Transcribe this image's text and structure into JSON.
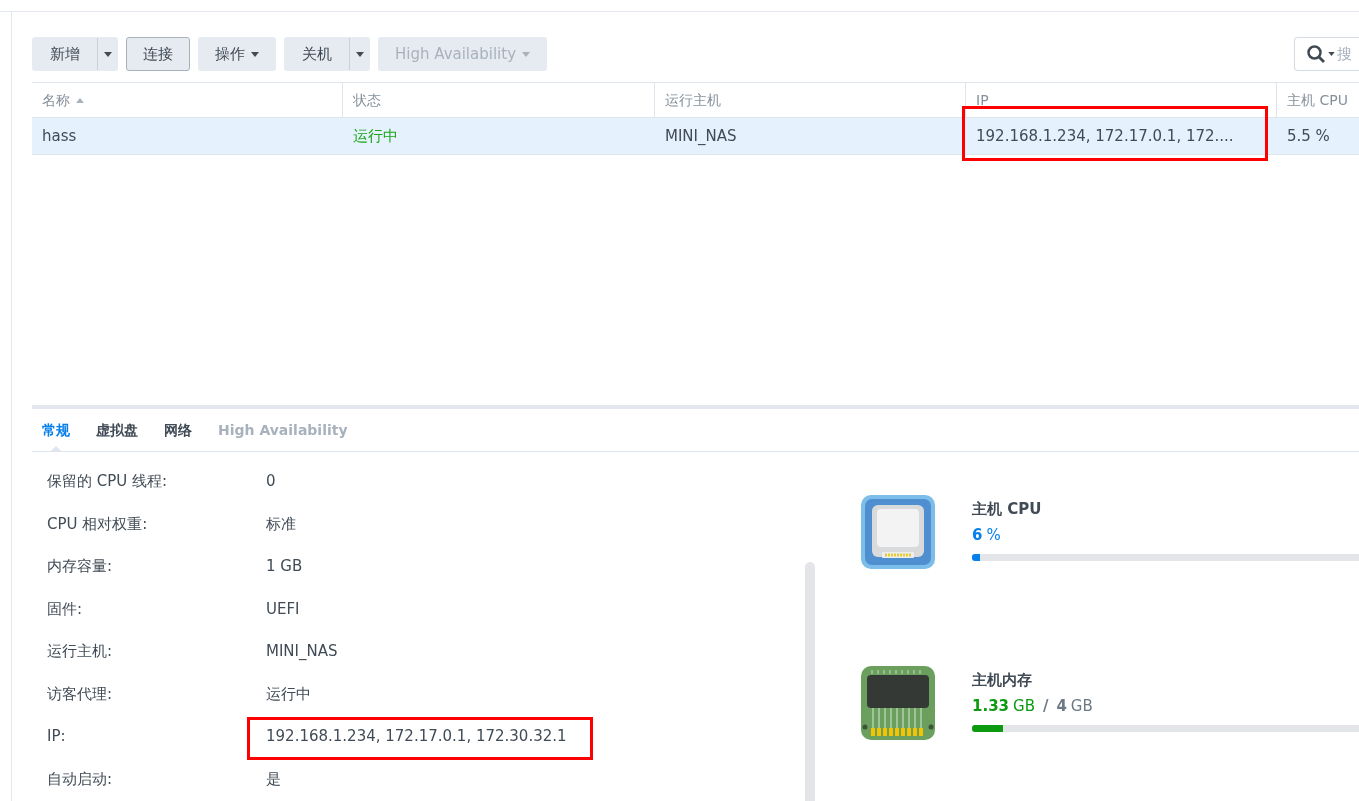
{
  "toolbar": {
    "buttons": [
      {
        "label": "新增",
        "kind": "split",
        "disabled": false,
        "pressed": false
      },
      {
        "label": "连接",
        "kind": "plain",
        "disabled": false,
        "pressed": true
      },
      {
        "label": "操作",
        "kind": "menu",
        "disabled": false,
        "pressed": false
      },
      {
        "label": "关机",
        "kind": "split",
        "disabled": false,
        "pressed": false
      },
      {
        "label": "High Availability",
        "kind": "menu",
        "disabled": true,
        "pressed": false
      }
    ],
    "search": {
      "placeholder": "搜"
    }
  },
  "table": {
    "columns": [
      {
        "label": "名称",
        "sorted": true
      },
      {
        "label": "状态",
        "sorted": false
      },
      {
        "label": "运行主机",
        "sorted": false
      },
      {
        "label": "IP",
        "sorted": false
      },
      {
        "label": "主机 CPU",
        "sorted": false
      }
    ],
    "rows": [
      {
        "selected": true,
        "cells": [
          {
            "text": "hass",
            "highlighted": false,
            "kind": "plain"
          },
          {
            "text": "运行中",
            "highlighted": false,
            "kind": "status"
          },
          {
            "text": "MINI_NAS",
            "highlighted": false,
            "kind": "plain"
          },
          {
            "text": "192.168.1.234, 172.17.0.1, 172....",
            "highlighted": true,
            "kind": "plain"
          },
          {
            "text": "5.5 %",
            "highlighted": false,
            "kind": "plain"
          }
        ]
      }
    ]
  },
  "detail_tabs": [
    {
      "label": "常规",
      "selected": true,
      "disabled": false
    },
    {
      "label": "虚拟盘",
      "selected": false,
      "disabled": false
    },
    {
      "label": "网络",
      "selected": false,
      "disabled": false
    },
    {
      "label": "High Availability",
      "selected": false,
      "disabled": true
    }
  ],
  "properties": [
    {
      "label": "保留的 CPU 线程:",
      "value": "0",
      "highlighted": false
    },
    {
      "label": "CPU 相对权重:",
      "value": "标准",
      "highlighted": false
    },
    {
      "label": "内存容量:",
      "value": "1 GB",
      "highlighted": false
    },
    {
      "label": "固件:",
      "value": "UEFI",
      "highlighted": false
    },
    {
      "label": "运行主机:",
      "value": "MINI_NAS",
      "highlighted": false
    },
    {
      "label": "访客代理:",
      "value": "运行中",
      "highlighted": false
    },
    {
      "label": "IP:",
      "value": "192.168.1.234, 172.17.0.1, 172.30.32.1",
      "highlighted": true
    },
    {
      "label": "自动启动:",
      "value": "是",
      "highlighted": false
    }
  ],
  "meters": [
    {
      "kind": "cpu",
      "title": "主机 CPU",
      "value": "6",
      "unit": "%",
      "level": 0.02
    },
    {
      "kind": "memory",
      "title": "主机内存",
      "value": "1.33",
      "unit": "GB",
      "separator": "/",
      "total": "4",
      "total_unit": "GB",
      "level": 0.08
    }
  ]
}
